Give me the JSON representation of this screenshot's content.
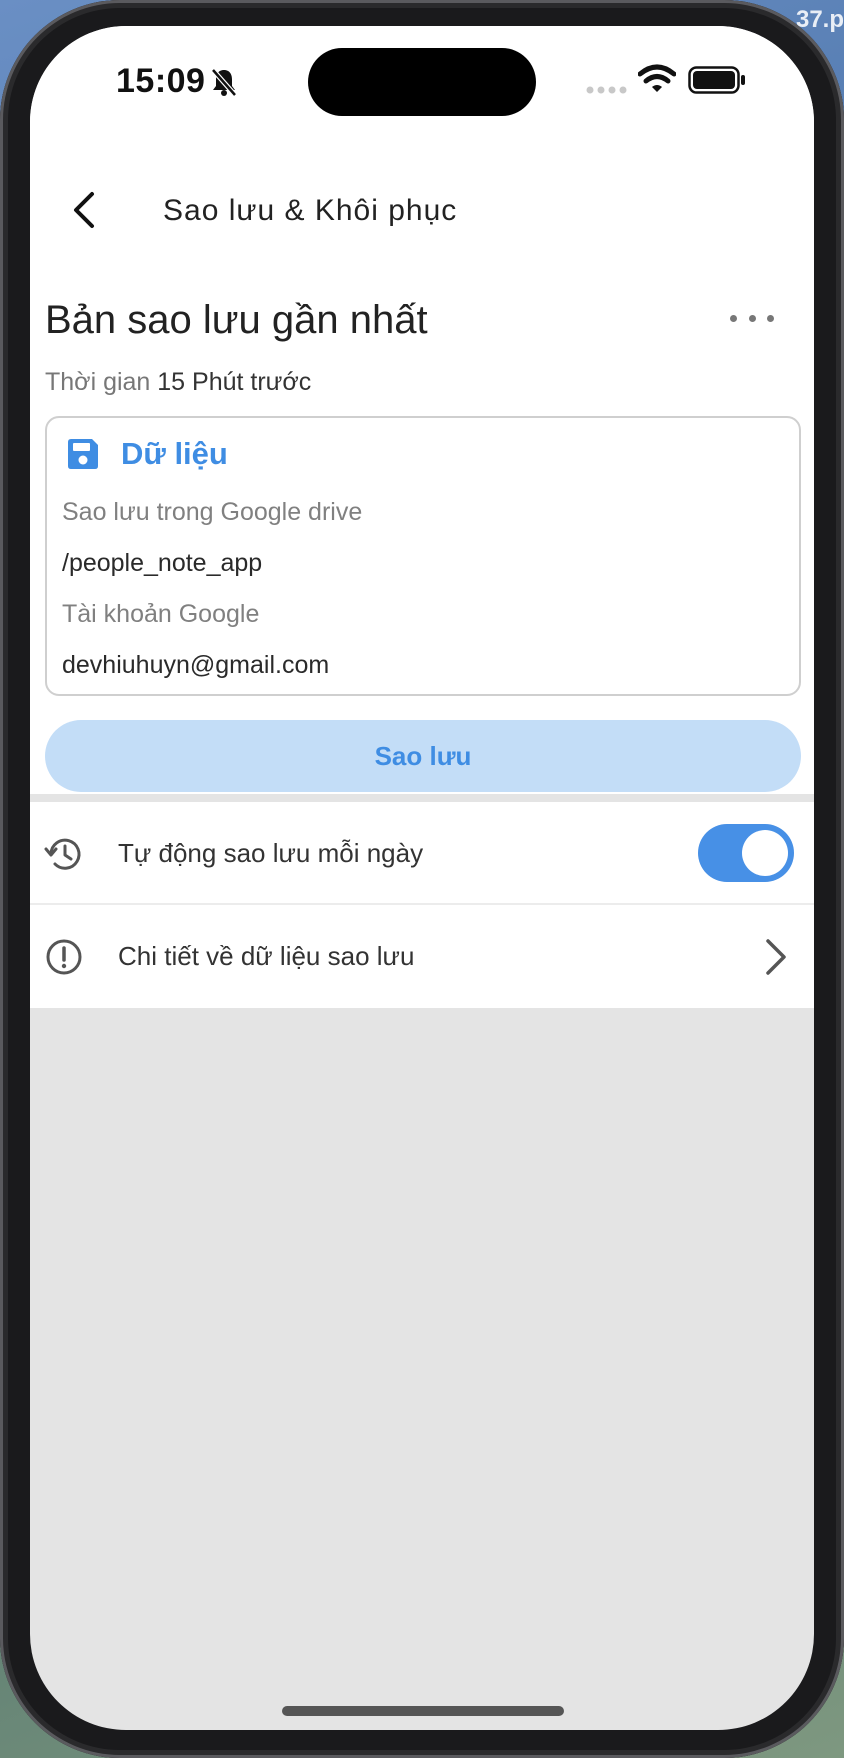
{
  "desktop": {
    "filename_fragment": ".37.p"
  },
  "status_bar": {
    "time": "15:09",
    "icons": [
      "bell-slash-icon",
      "signal-icon",
      "wifi-icon",
      "battery-icon"
    ]
  },
  "header": {
    "title": "Sao lưu & Khôi phục",
    "back_icon": "chevron-left-icon"
  },
  "backup": {
    "title": "Bản sao lưu gần nhất",
    "more_icon": "more-horizontal-icon",
    "time_label": "Thời gian",
    "time_value": "15 Phút trước",
    "card": {
      "icon": "save-icon",
      "title": "Dữ liệu",
      "location_label": "Sao lưu trong Google drive",
      "location_value": "/people_note_app",
      "account_label": "Tài khoản Google",
      "account_value": "devhiuhuyn@gmail.com"
    },
    "button_label": "Sao lưu"
  },
  "settings": {
    "items": [
      {
        "icon": "history-icon",
        "label": "Tự động sao lưu mỗi ngày",
        "toggle_on": true
      },
      {
        "icon": "info-circle-icon",
        "label": "Chi tiết về dữ liệu sao lưu",
        "trailing_icon": "chevron-right-icon"
      }
    ]
  },
  "colors": {
    "accent": "#3f8de3",
    "button_bg": "#c3ddf7",
    "toggle_on": "#4790e6",
    "background": "#e4e4e4"
  }
}
